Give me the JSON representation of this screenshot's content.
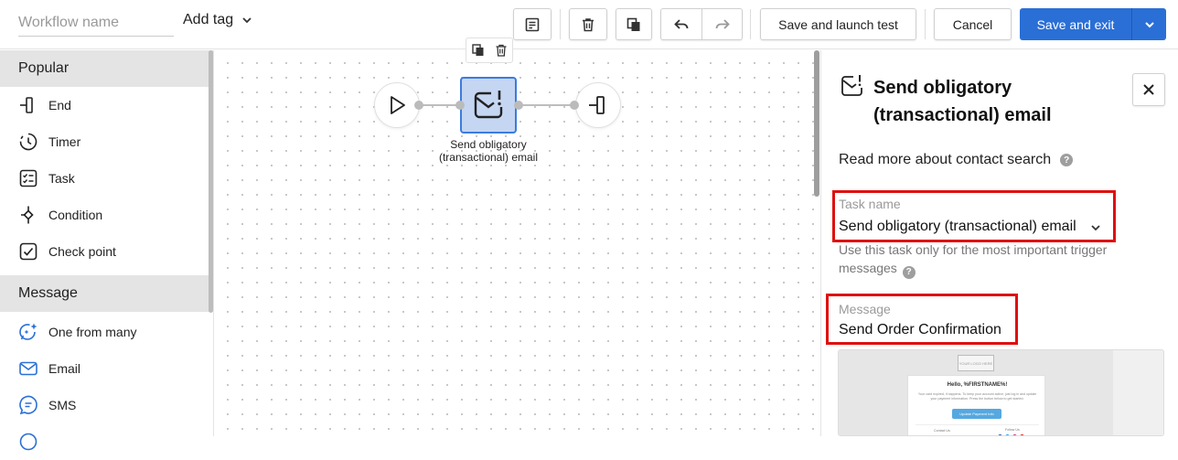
{
  "header": {
    "workflow_name_placeholder": "Workflow name",
    "add_tag_label": "Add tag",
    "save_launch_test_label": "Save and launch test",
    "cancel_label": "Cancel",
    "save_exit_label": "Save and exit",
    "accent_color": "#2a6fd6"
  },
  "sidebar": {
    "sections": [
      {
        "title": "Popular",
        "items": [
          {
            "label": "End",
            "icon": "end-icon"
          },
          {
            "label": "Timer",
            "icon": "timer-icon"
          },
          {
            "label": "Task",
            "icon": "task-icon"
          },
          {
            "label": "Condition",
            "icon": "condition-icon"
          },
          {
            "label": "Check point",
            "icon": "check-point-icon"
          }
        ]
      },
      {
        "title": "Message",
        "items": [
          {
            "label": "One from many",
            "icon": "sparkle-message-icon"
          },
          {
            "label": "Email",
            "icon": "email-icon"
          },
          {
            "label": "SMS",
            "icon": "sms-icon"
          }
        ]
      }
    ]
  },
  "canvas": {
    "selected_node_label": "Send obligatory (transactional) email"
  },
  "panel": {
    "title": "Send obligatory (transactional) email",
    "read_more": "Read more about contact search",
    "task_name_label": "Task name",
    "task_name_value": "Send obligatory (transactional) email",
    "task_help": "Use this task only for the most important trigger messages",
    "message_label": "Message",
    "message_value": "Send Order Confirmation",
    "highlight_color": "#e01010",
    "preview": {
      "logo": "YOUR LOGO HERE",
      "greeting": "Hello, %FIRSTNAME%!",
      "body": "Your card expired, it happens. To keep your account active, just log in and update your payment information. Press the button below to get started.",
      "button": "Update Payment Info",
      "contact": "Contact Us",
      "follow": "Follow Us"
    }
  }
}
